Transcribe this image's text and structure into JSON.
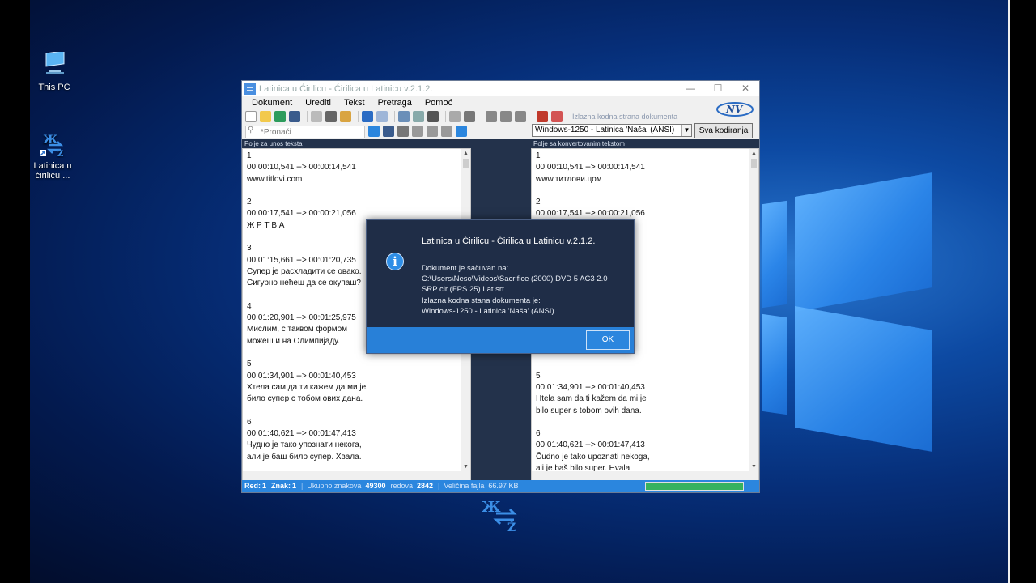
{
  "desktop": {
    "icons": [
      {
        "label": "This PC",
        "icon": "computer-icon"
      },
      {
        "label": "Latinica u\nćirilicu ...",
        "icon": "app-shortcut-icon"
      }
    ]
  },
  "app": {
    "title": "Latinica u Ćirilicu - Ćirilica u Latinicu v.2.1.2.",
    "window_buttons": [
      "—",
      "☐",
      "✕"
    ],
    "menu": [
      "Dokument",
      "Urediti",
      "Tekst",
      "Pretraga",
      "Pomoć"
    ],
    "toolbar": {
      "encoding_label": "Izlazna kodna strana dokumenta"
    },
    "search": {
      "placeholder": "*Pronaći"
    },
    "encoding_select": {
      "value": "Windows-1250 - Latinica 'Naša' (ANSI)"
    },
    "all_encodings_button": "Sva kodiranja",
    "left_panel": {
      "header": "Polje za unos teksta",
      "lines": [
        "1",
        "00:00:10,541 --> 00:00:14,541",
        "www.titlovi.com",
        "",
        "2",
        "00:00:17,541 --> 00:00:21,056",
        "Ж Р Т В А",
        "",
        "3",
        "00:01:15,661 --> 00:01:20,735",
        "Супер је расхладити се овако.",
        "Сигурно нећеш да се окупаш?",
        "",
        "4",
        "00:01:20,901 --> 00:01:25,975",
        "Мислим, с таквом формом",
        "можеш и на Олимпијаду.",
        "",
        "5",
        "00:01:34,901 --> 00:01:40,453",
        "Хтела сам да ти кажем да ми је",
        "било супер с тобом ових дана.",
        "",
        "6",
        "00:01:40,621 --> 00:01:47,413",
        "Чудно је тако упознати некога,",
        "али је баш било супер. Хвала."
      ]
    },
    "right_panel": {
      "header": "Polje sa konvertovanim tekstom",
      "lines": [
        "1",
        "00:00:10,541 --> 00:00:14,541",
        "www.титлови.цом",
        "",
        "2",
        "00:00:17,541 --> 00:00:21,056",
        "",
        "",
        "",
        "",
        "",
        "",
        "",
        "",
        "",
        "",
        "",
        "",
        "",
        "5",
        "00:01:34,901 --> 00:01:40,453",
        "Htela sam da ti kažem da mi je",
        "bilo super s tobom ovih dana.",
        "",
        "6",
        "00:01:40,621 --> 00:01:47,413",
        "Čudno je tako upoznati nekoga,",
        "ali je baš bilo super. Hvala."
      ]
    },
    "status": {
      "red_label": "Red:",
      "red_value": "1",
      "znak_label": "Znak:",
      "znak_value": "1",
      "ukupno_label": "Ukupno znakova",
      "ukupno_value": "49300",
      "redova_label": "redova",
      "redova_value": "2842",
      "velicina_label": "Veličina fajla",
      "velicina_value": "66.97 KB",
      "progress": 1.0
    }
  },
  "dialog": {
    "title": "Latinica u Ćirilicu - Ćirilica u Latinicu v.2.1.2.",
    "lines": [
      "Dokument je sačuvan na:",
      "C:\\Users\\Neso\\Videos\\Sacrifice (2000) DVD 5 AC3 2.0",
      "SRP cir (FPS 25) Lat.srt",
      "Izlazna kodna stana dokumenta je:",
      "Windows-1250 - Latinica 'Naša' (ANSI)."
    ],
    "ok_label": "OK"
  }
}
